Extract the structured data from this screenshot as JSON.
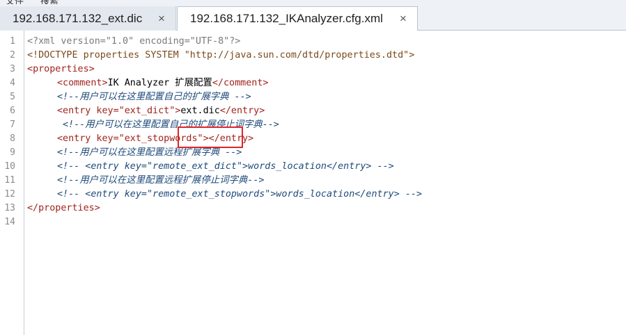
{
  "menu": {
    "items": [
      "文件",
      "搜索"
    ]
  },
  "tabs": [
    {
      "label": "192.168.171.132_ext.dic",
      "close": "×",
      "active": false
    },
    {
      "label": "192.168.171.132_IKAnalyzer.cfg.xml",
      "close": "×",
      "active": true
    }
  ],
  "editor": {
    "line_numbers": [
      "1",
      "2",
      "3",
      "4",
      "5",
      "6",
      "7",
      "8",
      "9",
      "10",
      "11",
      "12",
      "13",
      "14"
    ],
    "lines": {
      "l1": "<?xml version=\"1.0\" encoding=\"UTF-8\"?>",
      "l2": "<!DOCTYPE properties SYSTEM \"http://java.sun.com/dtd/properties.dtd\">",
      "l3_open": "<",
      "l3_name": "properties",
      "l3_close": ">",
      "l4_open": "<comment>",
      "l4_text": "IK Analyzer 扩展配置",
      "l4_close": "</comment>",
      "l5": "<!--用户可以在这里配置自己的扩展字典 -->",
      "l6_open": "<entry key=",
      "l6_val": "\"ext_dict\"",
      "l6_gt": ">",
      "l6_text": "ext.dic",
      "l6_close": "</entry>",
      "l7": "<!--用户可以在这里配置自己的扩展停止词字典-->",
      "l8_open": "<entry key=",
      "l8_val": "\"ext_stopwords\"",
      "l8_close": "></entry>",
      "l9": "<!--用户可以在这里配置远程扩展字典 -->",
      "l10": "<!-- <entry key=\"remote_ext_dict\">words_location</entry> -->",
      "l11": "<!--用户可以在这里配置远程扩展停止词字典-->",
      "l12": "<!-- <entry key=\"remote_ext_stopwords\">words_location</entry> -->",
      "l13": "</properties>"
    }
  },
  "colors": {
    "highlight": "#e0242a",
    "tag": "#a0231e",
    "comment": "#1f4a7a"
  }
}
